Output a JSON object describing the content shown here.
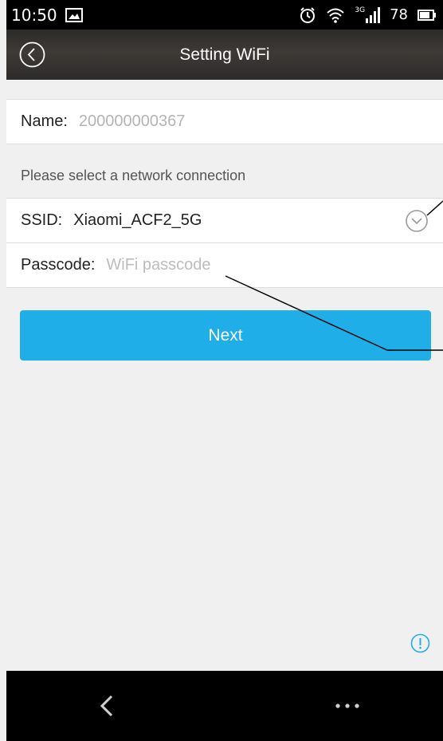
{
  "status_bar": {
    "time": "10:50",
    "network_type": "3G",
    "battery_level": "78",
    "icons": [
      "gallery-icon",
      "alarm-icon",
      "wifi-icon",
      "signal-icon",
      "battery-icon"
    ]
  },
  "header": {
    "title": "Setting WiFi",
    "back_icon": "back-circle-icon"
  },
  "form": {
    "name_label": "Name:",
    "name_value": "200000000367",
    "section_hint": "Please select a network connection",
    "ssid_label": "SSID:",
    "ssid_value": "Xiaomi_ACF2_5G",
    "ssid_dropdown_icon": "chevron-down-circle-icon",
    "passcode_label": "Passcode:",
    "passcode_placeholder": "WiFi passcode",
    "passcode_value": ""
  },
  "actions": {
    "next_label": "Next"
  },
  "info_icon": "info-icon",
  "nav_bar": {
    "icons": [
      "nav-back-icon",
      "nav-menu-icon"
    ]
  },
  "colors": {
    "accent": "#1faee8",
    "header_bg": "#3a3734",
    "page_bg": "#f0f0f0",
    "placeholder": "#bdbdbd"
  }
}
